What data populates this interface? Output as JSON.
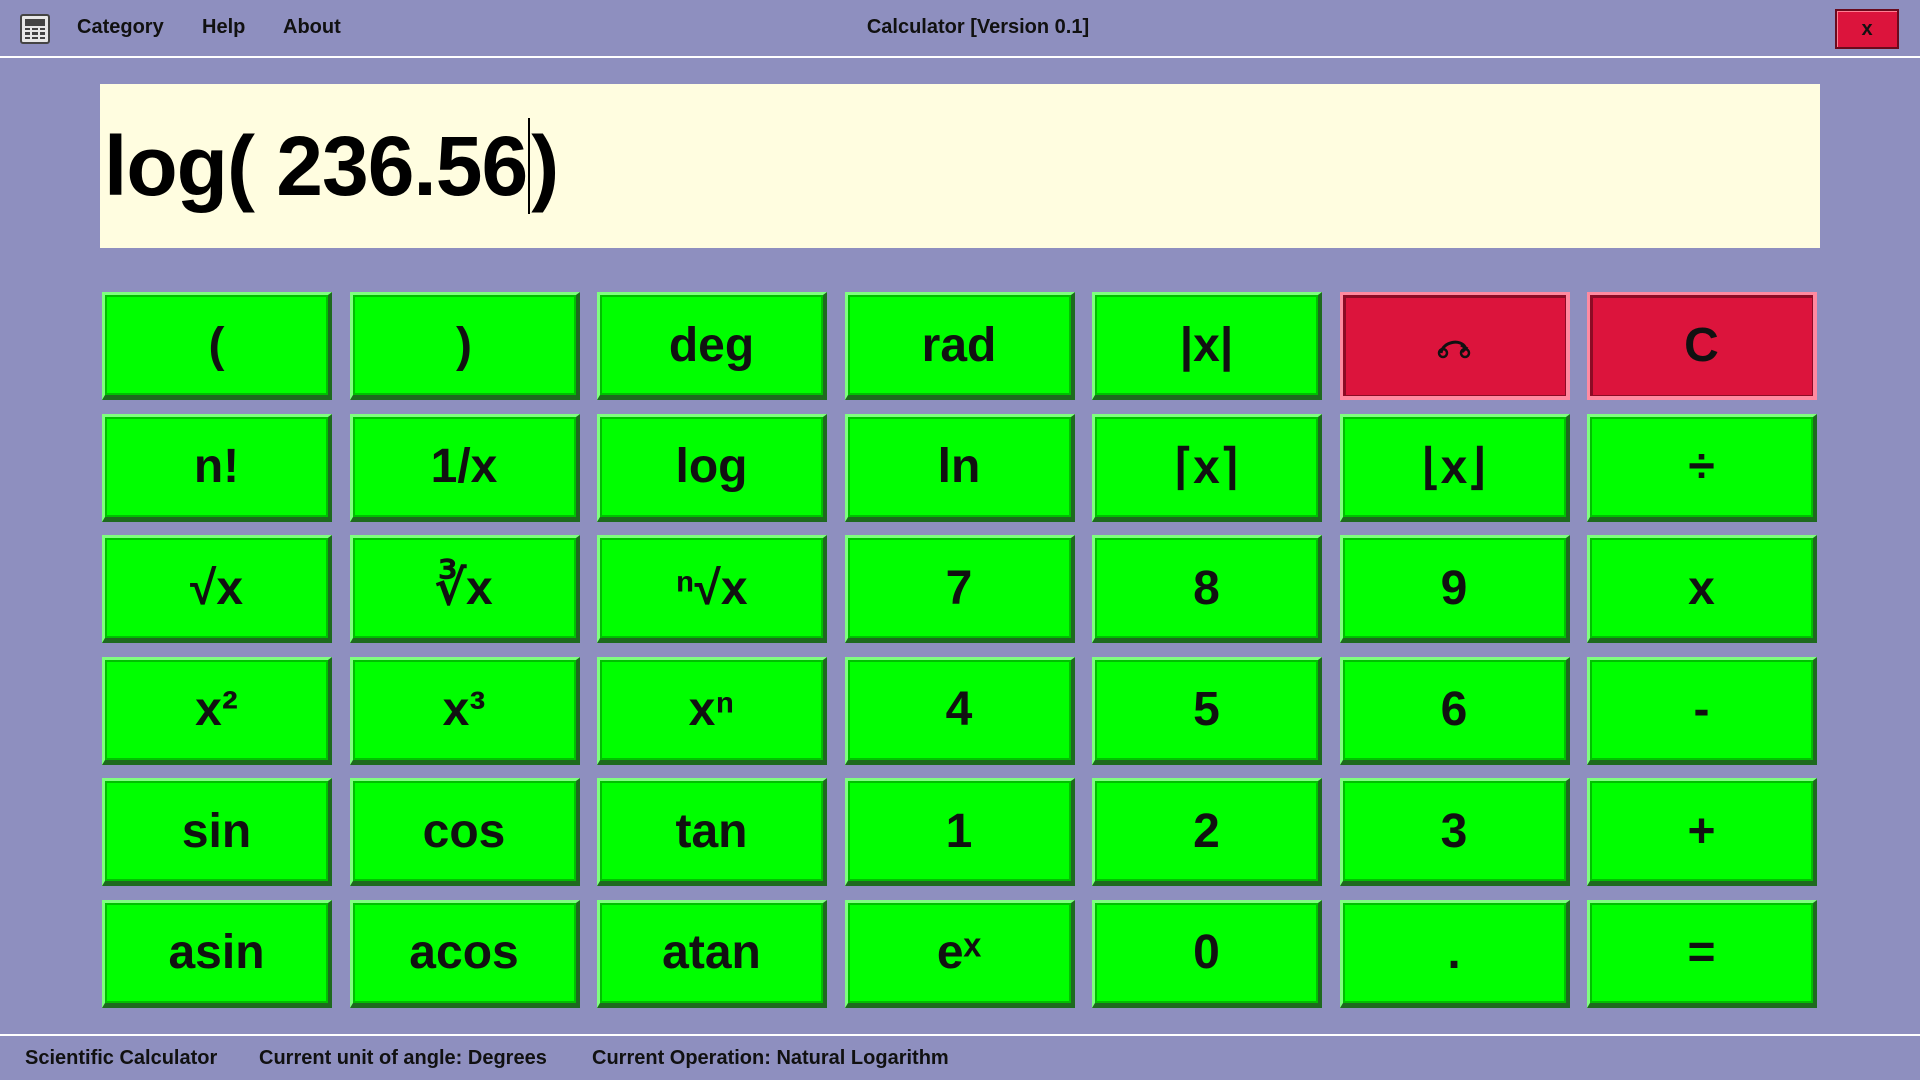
{
  "menu": {
    "icon": "calculator-icon",
    "items": [
      "Category",
      "Help",
      "About"
    ]
  },
  "window": {
    "title": "Calculator [Version 0.1]",
    "close_label": "x"
  },
  "display": {
    "before_cursor": "log( 236.56",
    "after_cursor": ")"
  },
  "keypad": {
    "rows": [
      [
        "(",
        ")",
        "deg",
        "rad",
        "|x|",
        "backspace",
        "C"
      ],
      [
        "n!",
        "1/x",
        "log",
        "ln",
        "⌈x⌉",
        "⌊x⌋",
        "÷"
      ],
      [
        "√x",
        "∛x",
        "ⁿ√x",
        "7",
        "8",
        "9",
        "x"
      ],
      [
        "x²",
        "x³",
        "xⁿ",
        "4",
        "5",
        "6",
        "-"
      ],
      [
        "sin",
        "cos",
        "tan",
        "1",
        "2",
        "3",
        "+"
      ],
      [
        "asin",
        "acos",
        "atan",
        "eˣ",
        "0",
        ".",
        "="
      ]
    ]
  },
  "status": {
    "mode": "Scientific Calculator",
    "angle_unit": "Current unit of angle: Degrees",
    "operation": "Current Operation: Natural Logarithm"
  },
  "colors": {
    "background": "#8e8fbf",
    "key_green": "#00ff00",
    "key_red": "#dc143c",
    "display_bg": "#fffde0"
  }
}
